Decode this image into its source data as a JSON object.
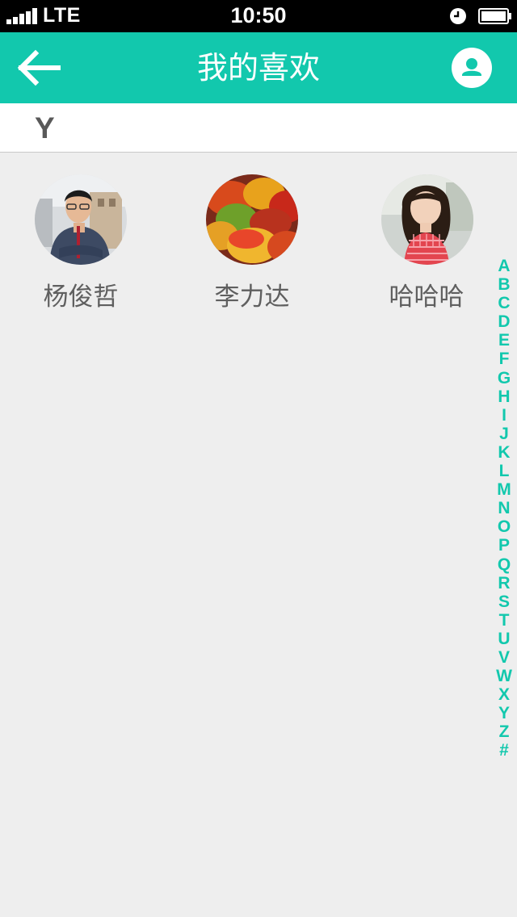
{
  "status_bar": {
    "carrier": "LTE",
    "time": "10:50"
  },
  "nav": {
    "title": "我的喜欢",
    "back_icon": "arrow-left-icon",
    "profile_icon": "user-icon"
  },
  "colors": {
    "accent": "#12c8ad",
    "background": "#eeeeee"
  },
  "section": {
    "letter": "Y"
  },
  "contacts": [
    {
      "name": "杨俊哲"
    },
    {
      "name": "李力达"
    },
    {
      "name": "哈哈哈"
    }
  ],
  "index_letters": [
    "A",
    "B",
    "C",
    "D",
    "E",
    "F",
    "G",
    "H",
    "I",
    "J",
    "K",
    "L",
    "M",
    "N",
    "O",
    "P",
    "Q",
    "R",
    "S",
    "T",
    "U",
    "V",
    "W",
    "X",
    "Y",
    "Z",
    "#"
  ]
}
